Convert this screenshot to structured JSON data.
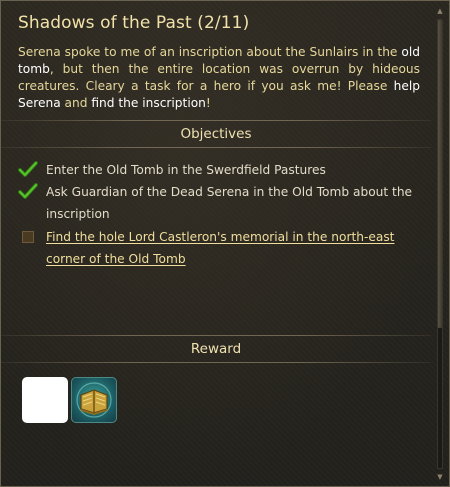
{
  "quest": {
    "title": "Shadows of the Past (2/11)",
    "description_parts": {
      "p1": "Serena spoke to me of an inscription about the Sunlairs in the ",
      "h1": "old tomb",
      "p2": ", but then the entire location was overrun by hideous creatures. Cleary a task for a hero if you ask me! Please ",
      "h2": "help Serena",
      "p3": " and ",
      "h3": "find the inscription",
      "p4": "!"
    }
  },
  "sections": {
    "objectives": "Objectives",
    "reward": "Reward"
  },
  "objectives": [
    {
      "text": "Enter the Old Tomb in the Swerdfield Pastures",
      "completed": true
    },
    {
      "text": "Ask Guardian of the Dead Serena in the Old Tomb about the inscription",
      "completed": true
    },
    {
      "text": "Find the hole Lord Castleron's memorial in the north-east corner of the Old Tomb",
      "completed": false
    }
  ],
  "rewards": [
    {
      "icon": "blank-slot-icon"
    },
    {
      "icon": "spellbook-icon"
    }
  ],
  "colors": {
    "title": "#f2e2a9",
    "description": "#e6d79a",
    "highlight": "#ffffff",
    "active_objective": "#f0de9d",
    "check_green": "#4fb82a"
  },
  "scroll_position": 0.0
}
